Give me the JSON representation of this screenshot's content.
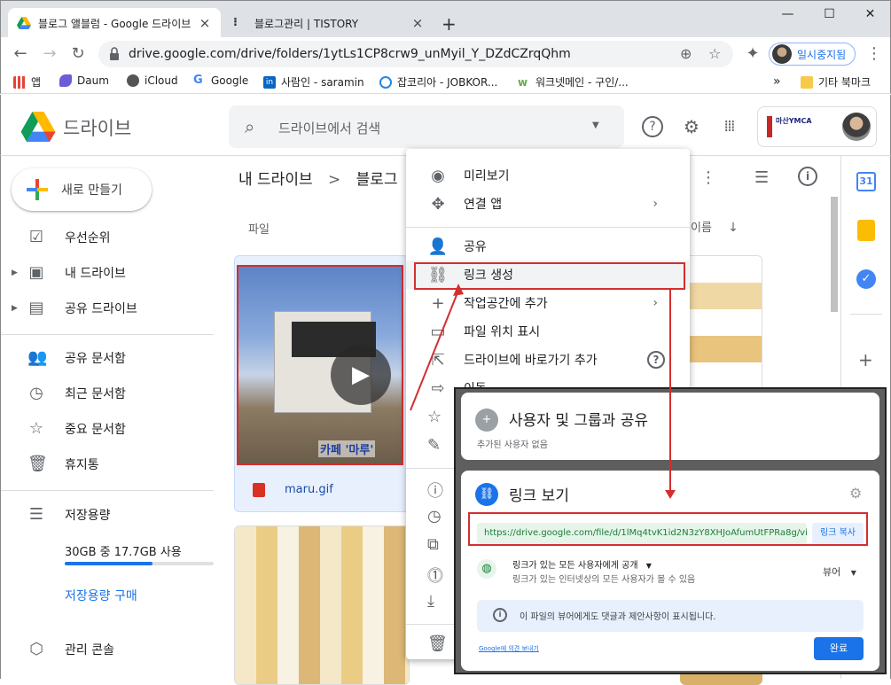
{
  "browser": {
    "tabs": [
      {
        "title": "블로그 앨블럼 - Google 드라이브",
        "close": "×"
      },
      {
        "title": "블로그관리 | TISTORY",
        "close": "×"
      }
    ],
    "new_tab": "+",
    "url": "drive.google.com/drive/folders/1ytLs1CP8crw9_unMyil_Y_DZdCZrqQhm",
    "profile_label": "일시중지됨",
    "window_controls": [
      "—",
      "☐",
      "✕"
    ]
  },
  "bookmarks": [
    {
      "label": "앱",
      "icon": "apps-icon",
      "color": "#5f6368"
    },
    {
      "label": "Daum",
      "icon": "daum-icon",
      "color": "#6b5cd8"
    },
    {
      "label": "iCloud",
      "icon": "apple-icon",
      "color": "#555555"
    },
    {
      "label": "Google",
      "icon": "google-icon",
      "color": "#4285f4"
    },
    {
      "label": "사람인 - saramin",
      "icon": "linkedin-icon",
      "color": "#0a66c2"
    },
    {
      "label": "잡코리아 - JOBKOR...",
      "icon": "jobkorea-icon",
      "color": "#1e88e5"
    },
    {
      "label": "워크넷메인 - 구인/...",
      "icon": "worknet-icon",
      "color": "#6aa84f"
    }
  ],
  "bookmarks_more": "»",
  "bookmarks_other": "기타 북마크",
  "drive": {
    "logo_text": "드라이브",
    "search_placeholder": "드라이브에서 검색",
    "org_label": "마산YMCA",
    "new_button": "새로 만들기",
    "nav": [
      {
        "label": "우선순위",
        "icon": "priority-icon"
      },
      {
        "label": "내 드라이브",
        "icon": "my-drive-icon"
      },
      {
        "label": "공유 드라이브",
        "icon": "shared-drive-icon"
      },
      {
        "label": "공유 문서함",
        "icon": "shared-with-me-icon"
      },
      {
        "label": "최근 문서함",
        "icon": "recent-icon"
      },
      {
        "label": "중요 문서함",
        "icon": "star-icon"
      },
      {
        "label": "휴지통",
        "icon": "trash-icon"
      },
      {
        "label": "저장용량",
        "icon": "storage-icon"
      }
    ],
    "storage_text": "30GB 중 17.7GB 사용",
    "storage_fraction": 0.59,
    "buy_storage": "저장용량 구매",
    "admin_console": "관리 콘솔",
    "breadcrumb_root": "내 드라이브",
    "breadcrumb_sep": ">",
    "breadcrumb_folder": "블로그",
    "files_header": "파일",
    "sort_label": "이름",
    "file_name": "maru.gif",
    "thumb_caption": "카페 '마루'"
  },
  "context_menu": {
    "items": [
      {
        "label": "미리보기",
        "icon": "eye-icon"
      },
      {
        "label": "연결 앱",
        "icon": "move-arrows-icon",
        "submenu": "›"
      },
      {
        "label": "공유",
        "icon": "person-add-icon"
      },
      {
        "label": "링크 생성",
        "icon": "link-icon"
      },
      {
        "label": "작업공간에 추가",
        "icon": "plus-icon",
        "submenu": "›"
      },
      {
        "label": "파일 위치 표시",
        "icon": "folder-icon"
      },
      {
        "label": "드라이브에 바로가기 추가",
        "icon": "shortcut-icon",
        "help": "?"
      },
      {
        "label": "이동",
        "icon": "move-to-icon"
      }
    ]
  },
  "share_dialog": {
    "title": "사용자 및 그룹과 공유",
    "subtitle": "추가된 사용자 없음",
    "link_title": "링크 보기",
    "link_url": "https://drive.google.com/file/d/1lMq4tvK1id2N3zY8XHJoAfumUtFPRa8g/vi...",
    "copy_button": "링크 복사",
    "access_title": "링크가 있는 모든 사용자에게 공개",
    "access_desc": "링크가 있는 인터넷상의 모든 사용자가 볼 수 있음",
    "role": "뷰어",
    "info": "이 파일의 뷰어에게도 댓글과 제안사항이 표시됩니다.",
    "feedback_prefix": "Google",
    "feedback_suffix": "에 의견 보내기",
    "done": "완료"
  }
}
